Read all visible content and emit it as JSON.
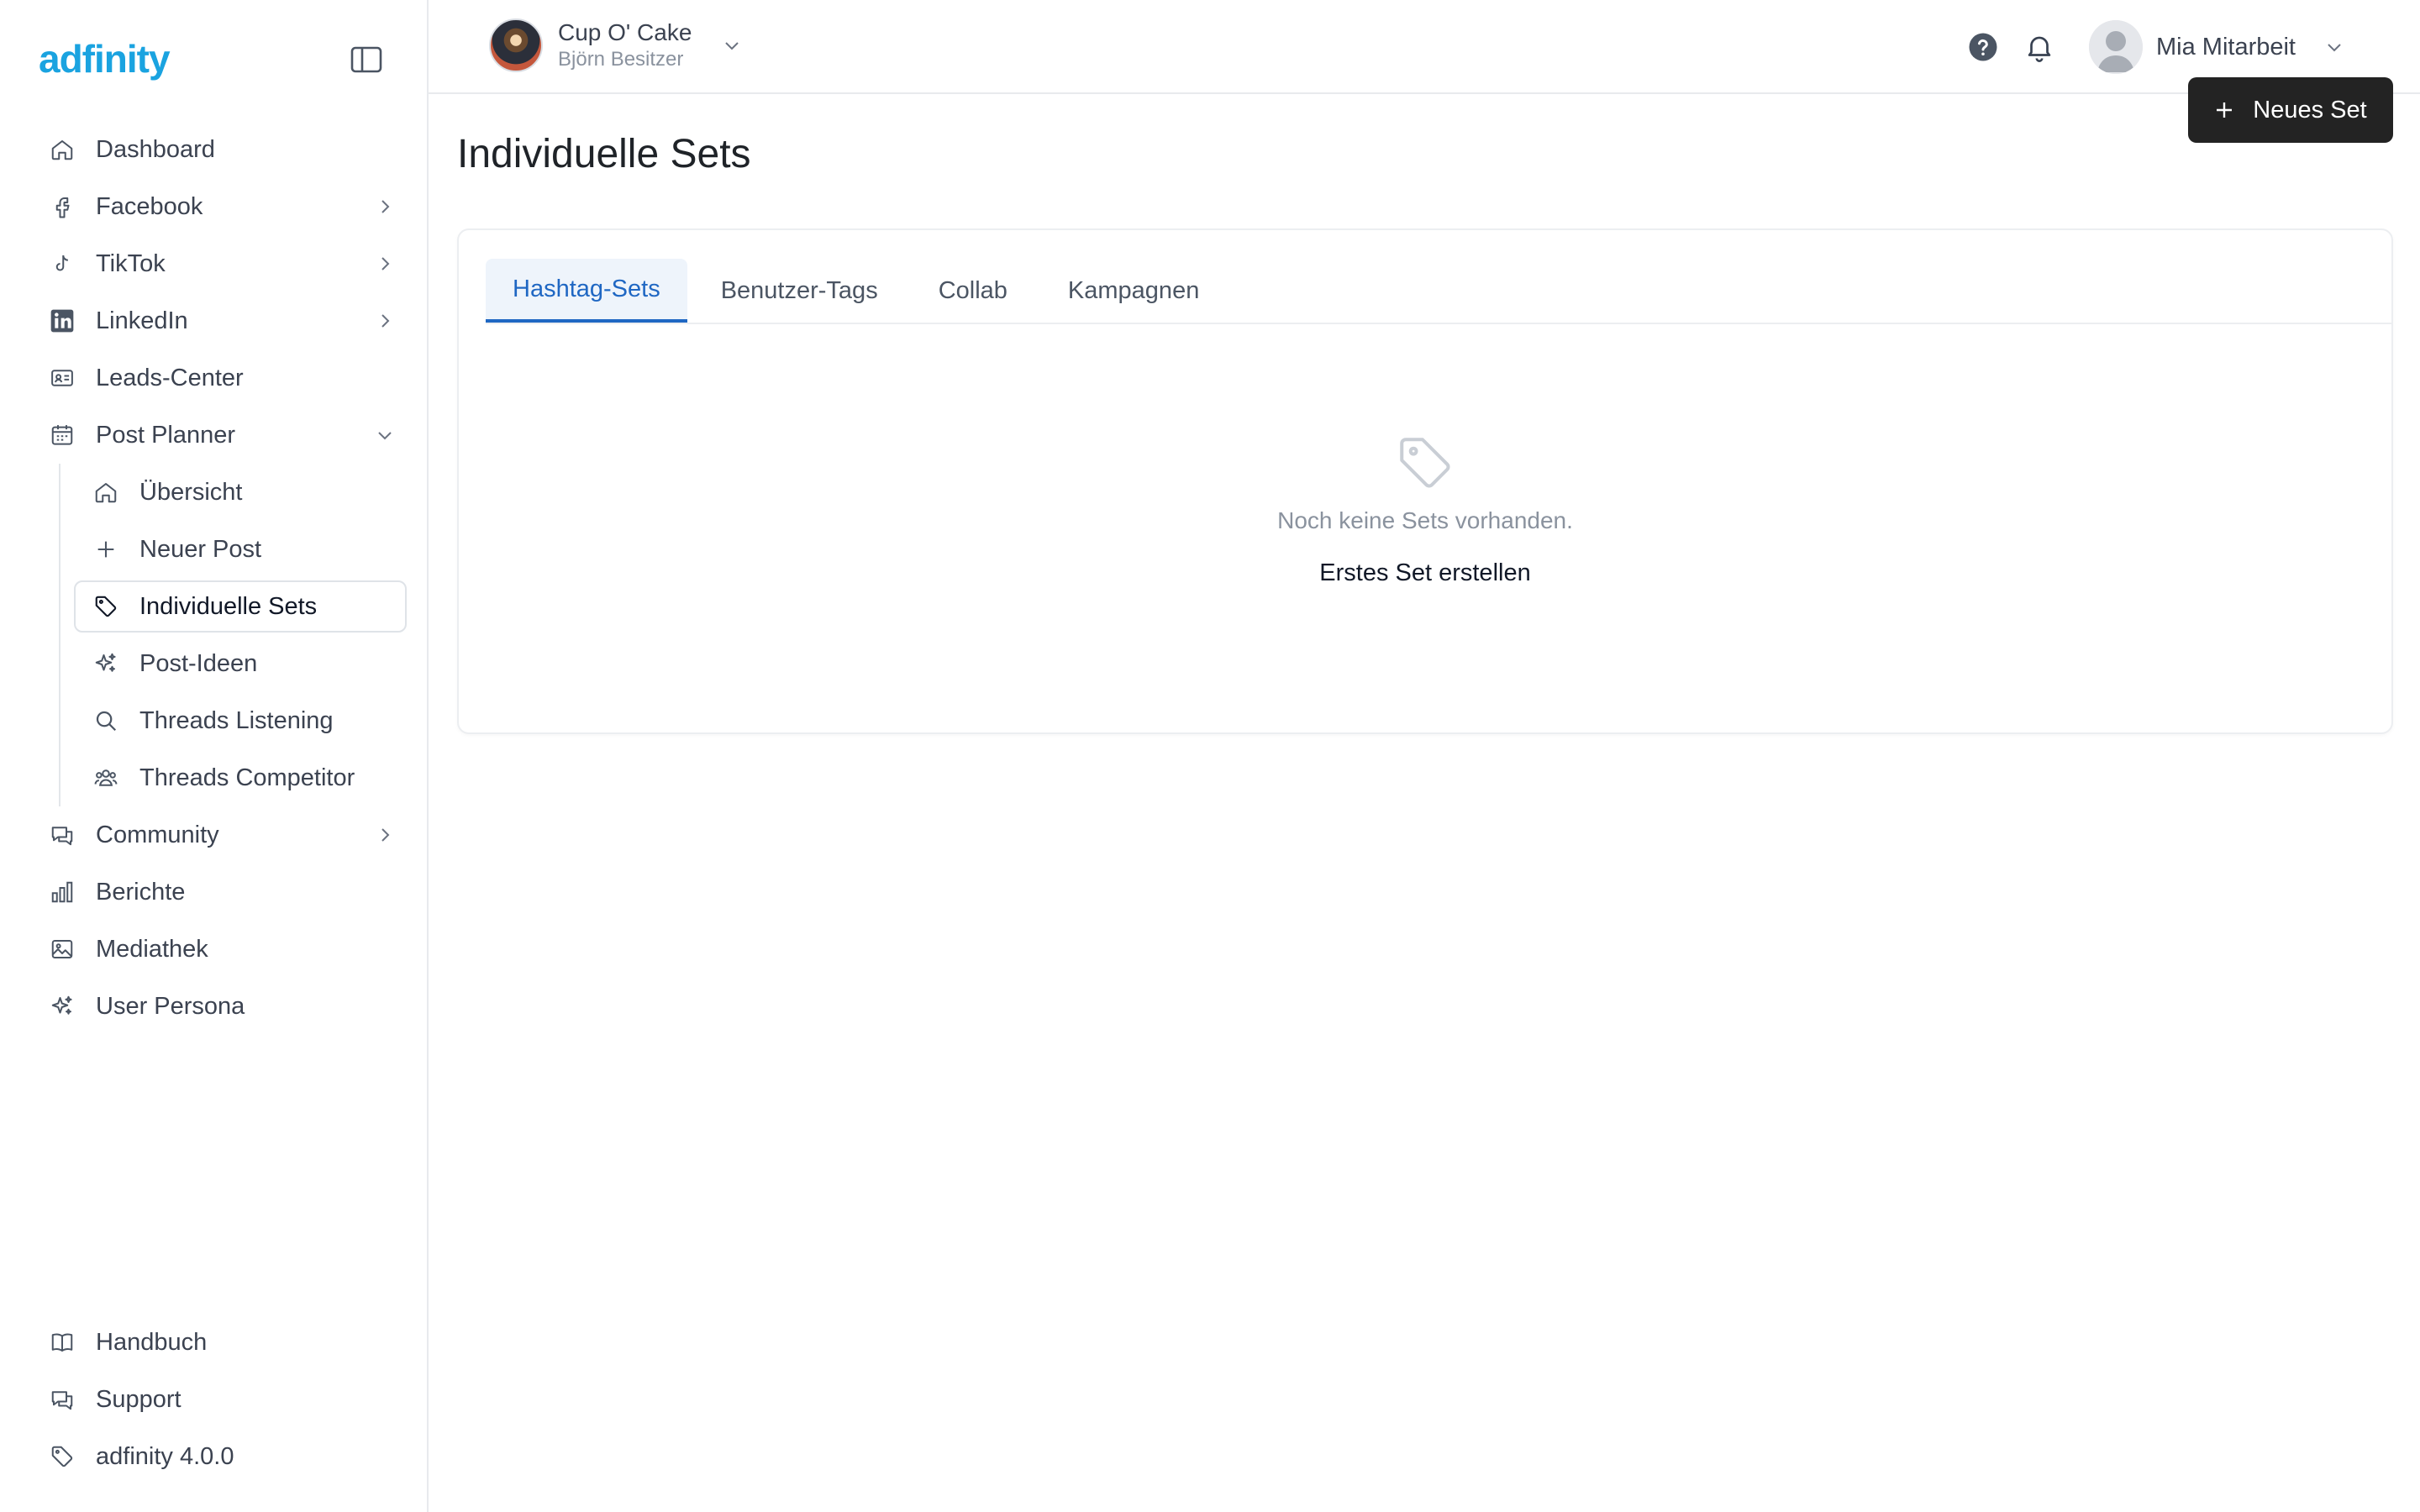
{
  "brand": {
    "logo_text": "adfinity",
    "color": "#1aa3e0"
  },
  "sidebar": {
    "items": [
      {
        "label": "Dashboard",
        "icon": "home-icon",
        "expandable": false
      },
      {
        "label": "Facebook",
        "icon": "facebook-icon",
        "expandable": true
      },
      {
        "label": "TikTok",
        "icon": "tiktok-icon",
        "expandable": true
      },
      {
        "label": "LinkedIn",
        "icon": "linkedin-icon",
        "expandable": true
      },
      {
        "label": "Leads-Center",
        "icon": "contact-card-icon",
        "expandable": false
      },
      {
        "label": "Post Planner",
        "icon": "calendar-icon",
        "expandable": true,
        "expanded": true
      }
    ],
    "post_planner_sub": [
      {
        "label": "Übersicht",
        "icon": "home-icon"
      },
      {
        "label": "Neuer Post",
        "icon": "plus-icon"
      },
      {
        "label": "Individuelle Sets",
        "icon": "tag-icon",
        "active": true
      },
      {
        "label": "Post-Ideen",
        "icon": "sparkles-icon"
      },
      {
        "label": "Threads Listening",
        "icon": "search-icon"
      },
      {
        "label": "Threads Competitor",
        "icon": "users-icon"
      }
    ],
    "items_after": [
      {
        "label": "Community",
        "icon": "chat-icon",
        "expandable": true
      },
      {
        "label": "Berichte",
        "icon": "bar-chart-icon",
        "expandable": false
      },
      {
        "label": "Mediathek",
        "icon": "image-icon",
        "expandable": false
      },
      {
        "label": "User Persona",
        "icon": "sparkles-icon",
        "expandable": false
      }
    ],
    "bottom": [
      {
        "label": "Handbuch",
        "icon": "book-icon"
      },
      {
        "label": "Support",
        "icon": "chat-icon"
      },
      {
        "label": "adfinity 4.0.0",
        "icon": "tag-icon"
      }
    ]
  },
  "header": {
    "account_name": "Cup O' Cake",
    "account_owner": "Björn Besitzer",
    "user_name": "Mia Mitarbeit"
  },
  "main": {
    "title": "Individuelle Sets",
    "new_button": "Neues Set",
    "tabs": [
      "Hashtag-Sets",
      "Benutzer-Tags",
      "Collab",
      "Kampagnen"
    ],
    "active_tab": "Hashtag-Sets",
    "empty_text": "Noch keine Sets vorhanden.",
    "empty_action": "Erstes Set erstellen",
    "accent_color": "#1f67c3"
  }
}
